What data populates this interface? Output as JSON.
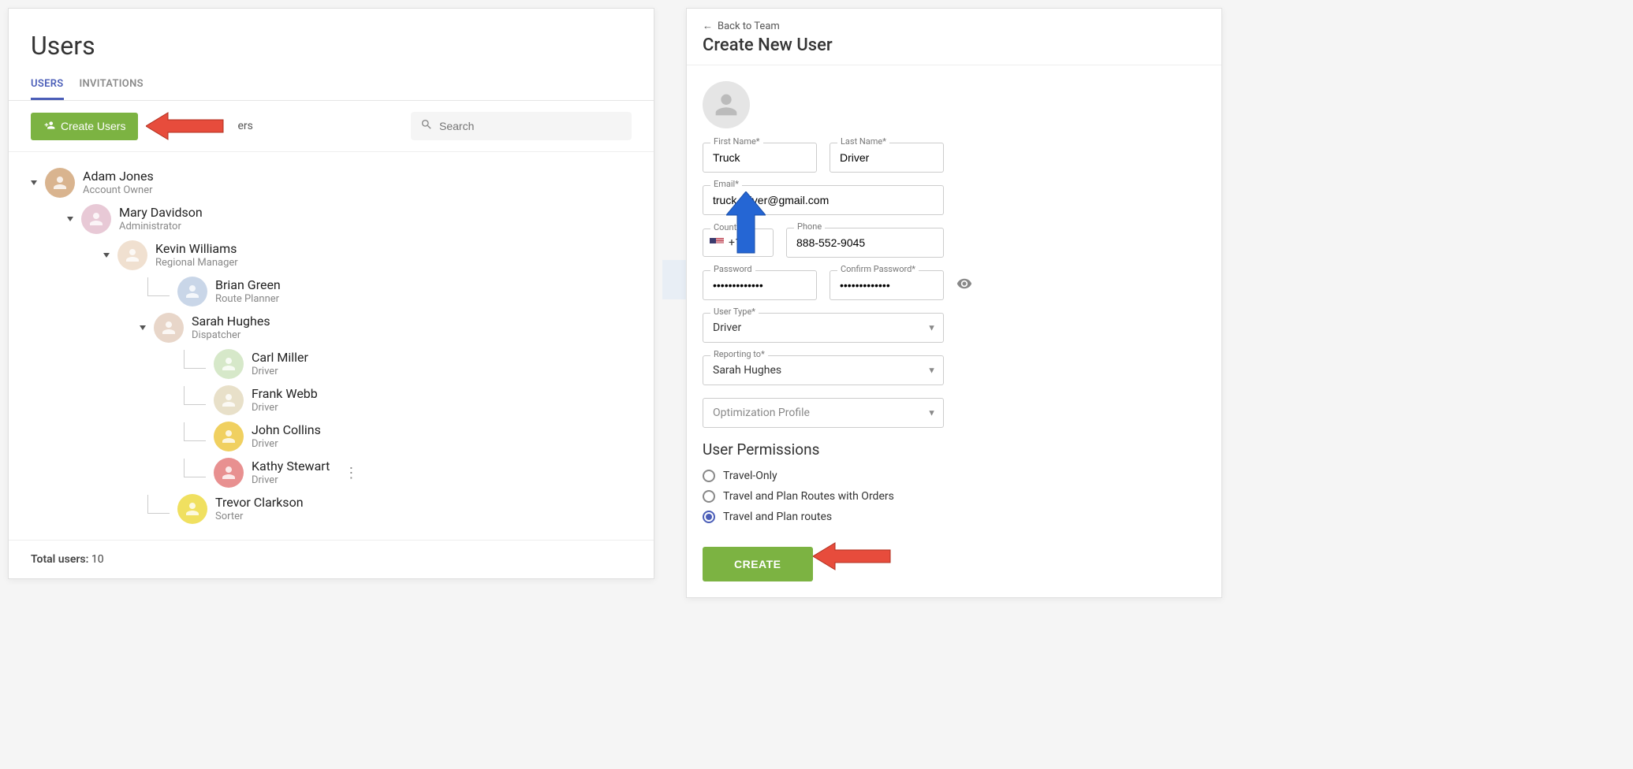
{
  "left": {
    "title": "Users",
    "tabs": {
      "users": "USERS",
      "invitations": "INVITATIONS"
    },
    "create_btn": "Create Users",
    "toolbar_text_suffix": "ers",
    "search_placeholder": "Search",
    "tree": [
      {
        "name": "Adam Jones",
        "role": "Account Owner",
        "level": 0,
        "caret": true,
        "bg": "#d9b48f"
      },
      {
        "name": "Mary Davidson",
        "role": "Administrator",
        "level": 1,
        "caret": true,
        "bg": "#e8c9d6"
      },
      {
        "name": "Kevin Williams",
        "role": "Regional Manager",
        "level": 2,
        "caret": true,
        "bg": "#f0e0d0"
      },
      {
        "name": "Brian Green",
        "role": "Route Planner",
        "level": 3,
        "caret": false,
        "bg": "#c9d6e8"
      },
      {
        "name": "Sarah Hughes",
        "role": "Dispatcher",
        "level": 3,
        "caret": true,
        "bg": "#e8d6c9"
      },
      {
        "name": "Carl Miller",
        "role": "Driver",
        "level": 4,
        "caret": false,
        "bg": "#d6e8c9"
      },
      {
        "name": "Frank Webb",
        "role": "Driver",
        "level": 4,
        "caret": false,
        "bg": "#e8e0c9"
      },
      {
        "name": "John Collins",
        "role": "Driver",
        "level": 4,
        "caret": false,
        "bg": "#f0d060"
      },
      {
        "name": "Kathy Stewart",
        "role": "Driver",
        "level": 4,
        "caret": false,
        "bg": "#e89090",
        "more": true
      },
      {
        "name": "Trevor Clarkson",
        "role": "Sorter",
        "level": 3,
        "caret": false,
        "bg": "#f0e060"
      }
    ],
    "footer_label": "Total users:",
    "footer_count": "10"
  },
  "right": {
    "back": "Back to Team",
    "title": "Create New User",
    "labels": {
      "first_name": "First Name*",
      "last_name": "Last Name*",
      "email": "Email*",
      "country": "Country",
      "phone": "Phone",
      "password": "Password",
      "confirm": "Confirm Password*",
      "user_type": "User Type*",
      "reporting": "Reporting to*",
      "opt_profile": "Optimization Profile"
    },
    "values": {
      "first_name": "Truck",
      "last_name": "Driver",
      "email": "truck.driver@gmail.com",
      "country_code": "+1",
      "phone": "888-552-9045",
      "password": "•••••••••••••",
      "confirm": "•••••••••••••",
      "user_type": "Driver",
      "reporting": "Sarah Hughes"
    },
    "permissions": {
      "title": "User Permissions",
      "options": [
        {
          "label": "Travel-Only",
          "checked": false
        },
        {
          "label": "Travel and Plan Routes with Orders",
          "checked": false
        },
        {
          "label": "Travel and Plan routes",
          "checked": true
        }
      ]
    },
    "create_btn": "CREATE"
  }
}
